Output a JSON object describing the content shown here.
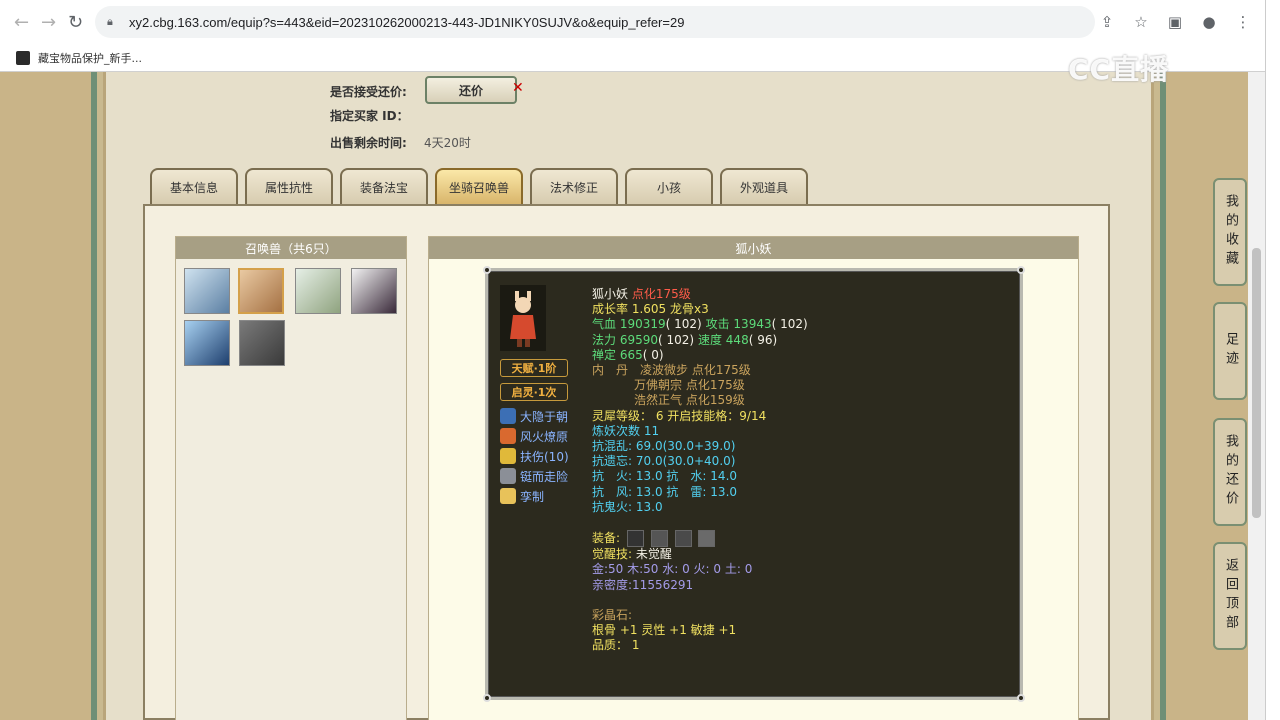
{
  "browser": {
    "url": "xy2.cbg.163.com/equip?s=443&eid=202310262000213-443-JD1NIKY0SUJV&o&equip_refer=29",
    "bookmark_label": "藏宝物品保护_新手..."
  },
  "trade": {
    "accept_counter_label": "是否接受还价:",
    "counter_button": "还价",
    "buyer_id_label": "指定买家 ID：",
    "remaining_label": "出售剩余时间:",
    "remaining_value": "4天20时"
  },
  "tabs": [
    "基本信息",
    "属性抗性",
    "装备法宝",
    "坐骑召唤兽",
    "法术修正",
    "小孩",
    "外观道具"
  ],
  "pet_panel": {
    "title": "召唤兽（共6只）"
  },
  "detail": {
    "title": "狐小妖",
    "badges": {
      "talent": "天赋·1阶",
      "spirit": "启灵·1次"
    },
    "skills": [
      "大隐于朝",
      "风火燎原",
      "扶伤(10)",
      "铤而走险",
      "孪制"
    ],
    "name": "狐小妖",
    "level": "点化175级",
    "growth": "成长率 1.605 龙骨x3",
    "hp_label": "气血",
    "hp_value": "190319",
    "hp_pts": "( 102)",
    "atk_label": "攻击",
    "atk_value": "13943",
    "atk_pts": "( 102)",
    "mp_label": "法力",
    "mp_value": "69590",
    "mp_pts": "( 102)",
    "spd_label": "速度",
    "spd_value": "448",
    "spd_pts": "( 96)",
    "cha_label": "禅定",
    "cha_value": "665",
    "cha_pts": "( 0)",
    "neidan_label": "内　丹",
    "neidan": [
      "凌波微步 点化175级",
      "万佛朝宗 点化175级",
      "浩然正气 点化159级"
    ],
    "spirit_line": "灵犀等级： 6 开启技能格：9/14",
    "refine_line": "炼妖次数 11",
    "res_chaos_label": "抗混乱:",
    "res_chaos_val": "69.0(30.0+39.0)",
    "res_forget_label": "抗遗忘:",
    "res_forget_val": "70.0(30.0+40.0)",
    "res_fire_label": "抗　火:",
    "res_fire_val": "13.0",
    "res_water_label": "抗　水:",
    "res_water_val": "14.0",
    "res_wind_label": "抗　风:",
    "res_wind_val": "13.0",
    "res_thunder_label": "抗　雷:",
    "res_thunder_val": "13.0",
    "res_ghost_label": "抗鬼火:",
    "res_ghost_val": "13.0",
    "equip_label": "装备:",
    "awaken_label": "觉醒技:",
    "awaken_value": "未觉醒",
    "elements": "金:50 木:50 水: 0 火: 0 土: 0",
    "intimacy": "亲密度:11556291",
    "crystal_label": "彩晶石:",
    "crystal_value": "根骨 +1 灵性 +1 敏捷 +1",
    "quality": "品质： 1"
  },
  "side_buttons": [
    "我的收藏",
    "足迹",
    "我的还价",
    "返回顶部"
  ],
  "watermark": "CC直播",
  "colors": {
    "accent": "#d4a04a",
    "panel_bg": "#2c2a1e",
    "tab_active": "#d9b56b"
  }
}
